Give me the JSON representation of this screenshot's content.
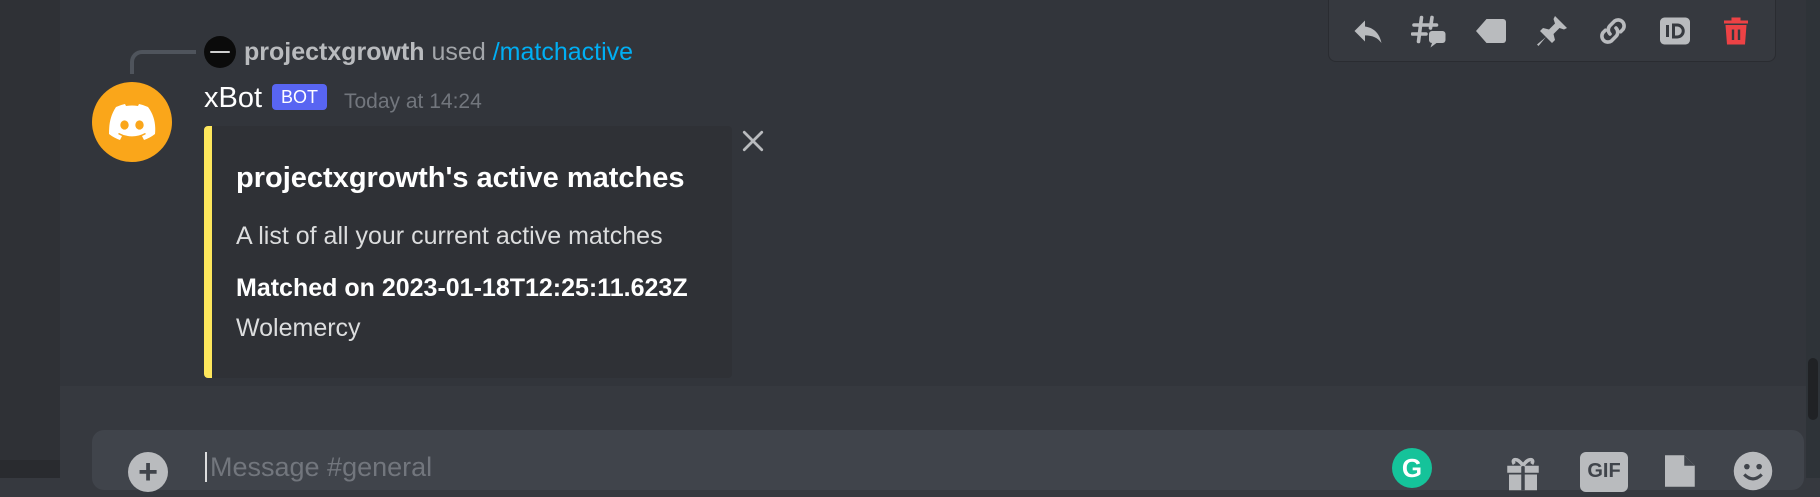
{
  "reply": {
    "username": "projectxgrowth",
    "verb": "used",
    "command": "/matchactive"
  },
  "message": {
    "username": "xBot",
    "badge": "BOT",
    "timestamp": "Today at 14:24"
  },
  "embed": {
    "title": "projectxgrowth's active matches",
    "description": "A list of all your current active matches",
    "field_name": "Matched on 2023-01-18T12:25:11.623Z",
    "field_value": "Wolemercy",
    "accent_color": "#fee75c"
  },
  "toolbar": {
    "items": [
      "reply-icon",
      "create-thread-icon",
      "tag-icon",
      "pin-icon",
      "link-icon",
      "id-icon",
      "trash-icon"
    ]
  },
  "composer": {
    "placeholder": "Message #general",
    "gif_label": "GIF",
    "grammarly_label": "G"
  },
  "colors": {
    "background": "#36393f",
    "bot_badge": "#5865f2",
    "avatar": "#faa61a",
    "command_link": "#00aff4",
    "delete": "#ed4245"
  }
}
